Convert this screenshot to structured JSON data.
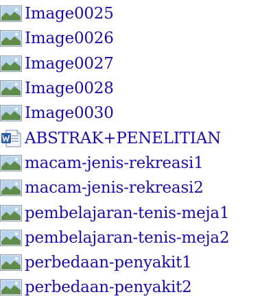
{
  "files": [
    {
      "name": "Image0025",
      "icon": "image-file-icon"
    },
    {
      "name": "Image0026",
      "icon": "image-file-icon"
    },
    {
      "name": "Image0027",
      "icon": "image-file-icon"
    },
    {
      "name": "Image0028",
      "icon": "image-file-icon"
    },
    {
      "name": "Image0030",
      "icon": "image-file-icon"
    },
    {
      "name": "ABSTRAK+PENELITIAN",
      "icon": "word-document-icon"
    },
    {
      "name": "macam-jenis-rekreasi1",
      "icon": "image-file-icon"
    },
    {
      "name": "macam-jenis-rekreasi2",
      "icon": "image-file-icon"
    },
    {
      "name": "pembelajaran-tenis-meja1",
      "icon": "image-file-icon"
    },
    {
      "name": "pembelajaran-tenis-meja2",
      "icon": "image-file-icon"
    },
    {
      "name": "perbedaan-penyakit1",
      "icon": "image-file-icon"
    },
    {
      "name": "perbedaan-penyakit2",
      "icon": "image-file-icon"
    }
  ],
  "colors": {
    "link": "#1a0dab",
    "background": "#ffffff"
  }
}
